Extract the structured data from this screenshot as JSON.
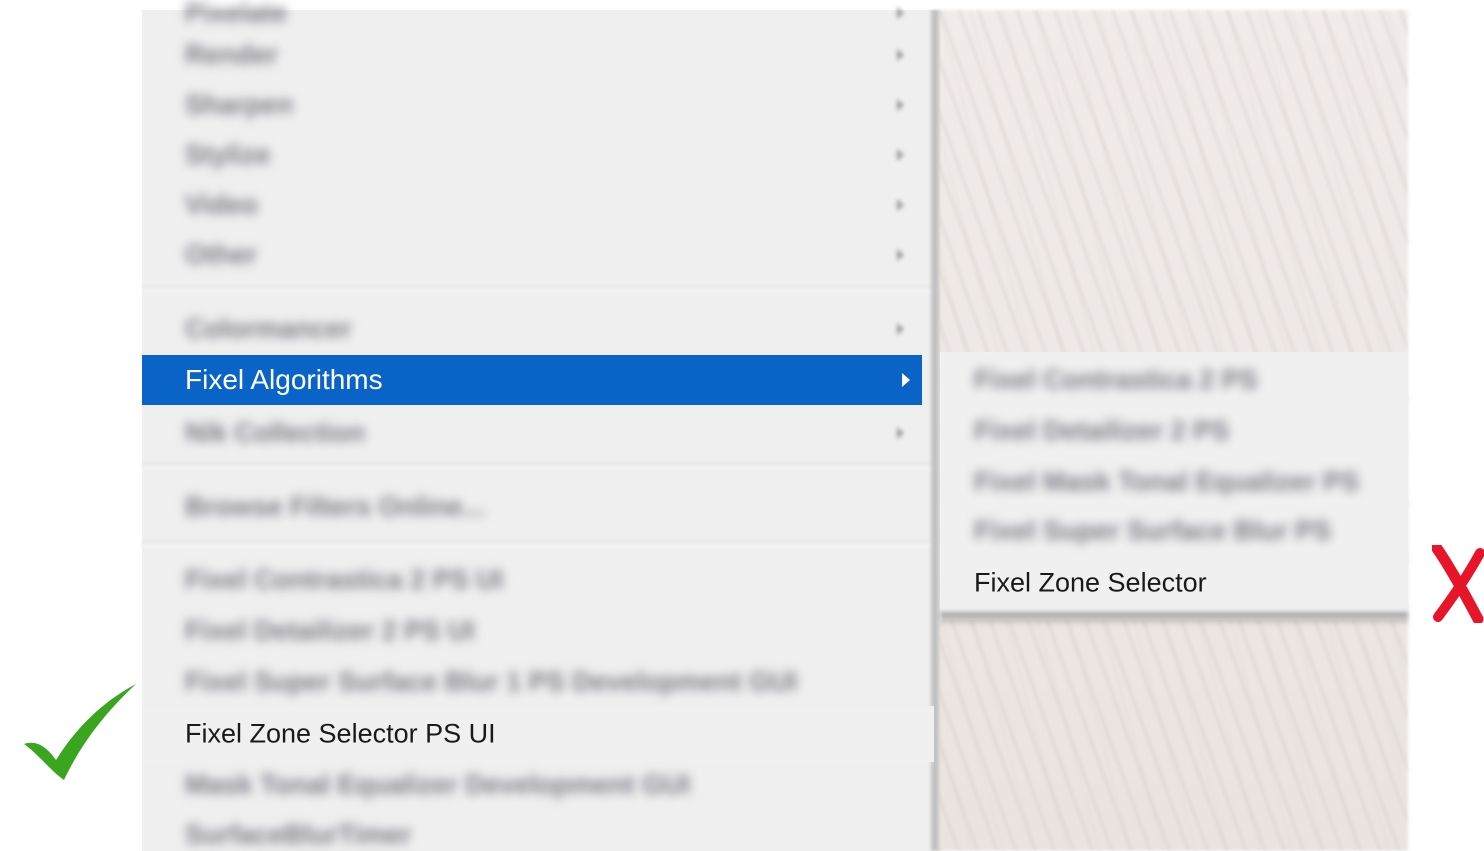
{
  "main_menu": {
    "blurred_items_top": [
      {
        "label": "Pixelate",
        "has_submenu": true
      },
      {
        "label": "Render",
        "has_submenu": true
      },
      {
        "label": "Sharpen",
        "has_submenu": true
      },
      {
        "label": "Stylize",
        "has_submenu": true
      },
      {
        "label": "Video",
        "has_submenu": true
      },
      {
        "label": "Other",
        "has_submenu": true
      }
    ],
    "blurred_group_two": [
      {
        "label": "Colormancer",
        "has_submenu": true
      }
    ],
    "highlighted_item": {
      "label": "Fixel Algorithms",
      "has_submenu": true
    },
    "after_highlight": [
      {
        "label": "Nik Collection",
        "has_submenu": true
      }
    ],
    "browse_item": {
      "label": "Browse Filters Online..."
    },
    "blurred_group_three": [
      {
        "label": "Fixel Contrastica 2 PS UI"
      },
      {
        "label": "Fixel Detailizer 2 PS UI"
      },
      {
        "label": "Fixel Super Surface Blur 1 PS Development GUI"
      }
    ],
    "zone_selector_item": {
      "label": "Fixel Zone Selector PS UI"
    },
    "blurred_group_four": [
      {
        "label": "Mask Tonal Equalizer Development GUI"
      },
      {
        "label": "SurfaceBlurTimer"
      }
    ]
  },
  "submenu": {
    "blurred_items": [
      {
        "label": "Fixel Contrastica 2 PS"
      },
      {
        "label": "Fixel Detailizer 2 PS"
      },
      {
        "label": "Fixel Mask Tonal Equalizer PS"
      },
      {
        "label": "Fixel Super Surface Blur PS"
      }
    ],
    "zone_selector": {
      "label": "Fixel Zone Selector"
    }
  },
  "marks": {
    "check_color": "#3aa61f",
    "x_color": "#e8142a"
  },
  "colors": {
    "highlight": "#0a63c7",
    "menu_bg": "#efefef"
  }
}
